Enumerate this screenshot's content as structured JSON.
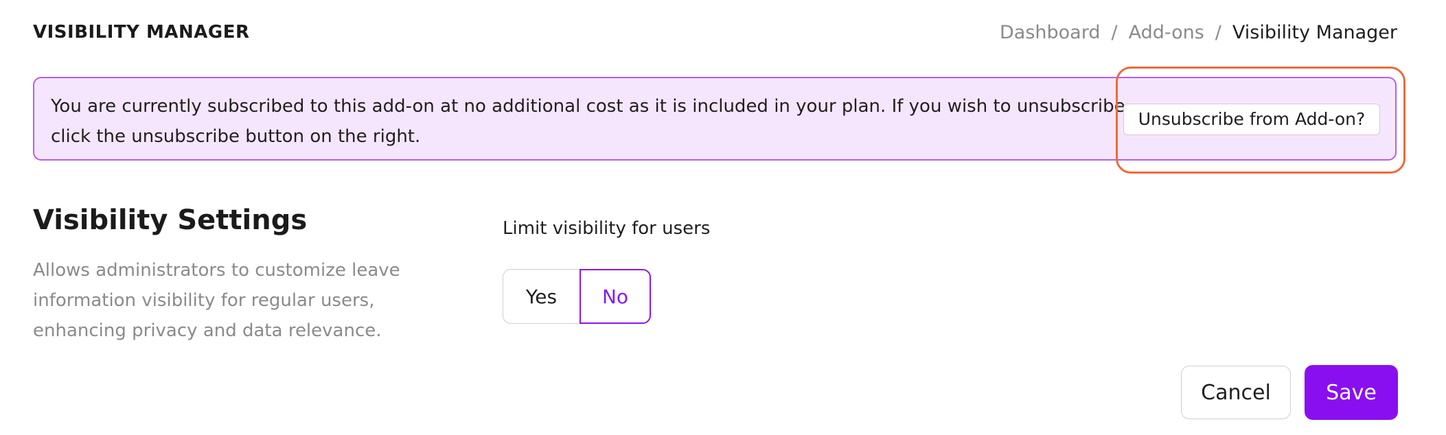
{
  "header": {
    "title": "VISIBILITY MANAGER",
    "breadcrumb": {
      "items": [
        "Dashboard",
        "Add-ons",
        "Visibility Manager"
      ],
      "separator": "/"
    }
  },
  "banner": {
    "message": "You are currently subscribed to this add-on at no additional cost as it is included in your plan. If you wish to unsubscribe, click the unsubscribe button on the right.",
    "unsubscribe_label": "Unsubscribe from Add-on?"
  },
  "settings": {
    "title": "Visibility Settings",
    "description": "Allows administrators to customize leave information visibility for regular users, enhancing privacy and data relevance.",
    "field_label": "Limit visibility for users",
    "options": [
      "Yes",
      "No"
    ],
    "selected": "No"
  },
  "actions": {
    "cancel_label": "Cancel",
    "save_label": "Save"
  },
  "colors": {
    "accent": "#8a0ff0",
    "banner_bg": "#f6e6fd",
    "banner_border": "#b45df0",
    "highlight_ring": "#ec6a3c"
  }
}
